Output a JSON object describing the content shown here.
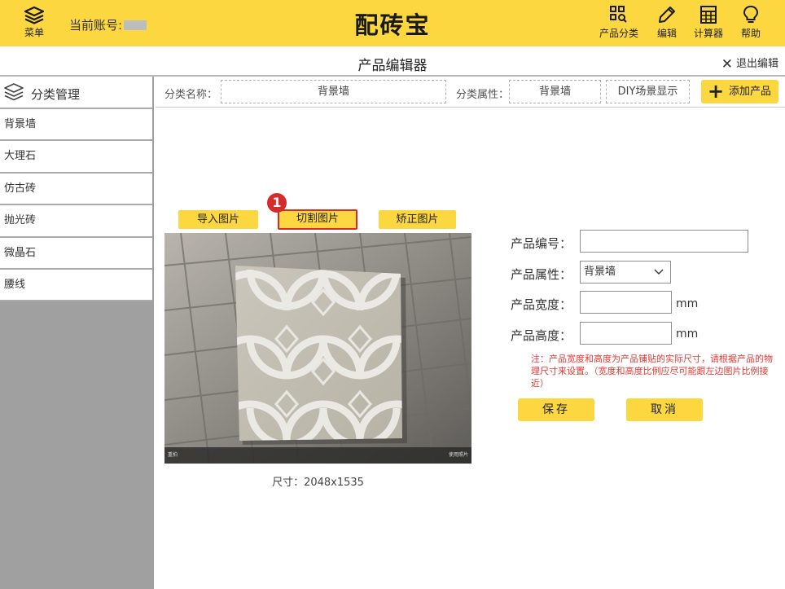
{
  "topbar": {
    "menu_label": "菜单",
    "account_label": "当前账号:",
    "app_title": "配砖宝",
    "tools": [
      {
        "label": "产品分类",
        "icon": "category-search-icon"
      },
      {
        "label": "编辑",
        "icon": "pencil-icon"
      },
      {
        "label": "计算器",
        "icon": "calculator-icon"
      },
      {
        "label": "帮助",
        "icon": "lightbulb-icon"
      }
    ],
    "accent_color": "#fcd73f"
  },
  "subheader": {
    "title": "产品编辑器",
    "exit_label": "退出编辑"
  },
  "sidebar": {
    "title": "分类管理",
    "items": [
      {
        "label": "背景墙"
      },
      {
        "label": "大理石"
      },
      {
        "label": "仿古砖"
      },
      {
        "label": "抛光砖"
      },
      {
        "label": "微晶石"
      },
      {
        "label": "腰线"
      }
    ]
  },
  "filter": {
    "category_name_label": "分类名称：",
    "category_name_value": "背景墙",
    "category_attr_label": "分类属性：",
    "category_attr_value": "背景墙",
    "diy_label": "DIY场景显示",
    "add_product_label": "添加产品"
  },
  "image_tools": {
    "import_label": "导入图片",
    "cut_label": "切割图片",
    "correct_label": "矫正图片",
    "step_badge": "1"
  },
  "photo": {
    "strip_left": "重拍",
    "strip_right": "使用照片",
    "size_text": "尺寸：2048x1535"
  },
  "form": {
    "product_no_label": "产品编号：",
    "product_no_value": "",
    "product_attr_label": "产品属性：",
    "product_attr_selected": "背景墙",
    "width_label": "产品宽度：",
    "width_value": "",
    "height_label": "产品高度：",
    "height_value": "",
    "unit": "mm",
    "note": "注：产品宽度和高度为产品铺贴的实际尺寸，请根据产品的物理尺寸来设置。（宽度和高度比例应尽可能跟左边图片比例接近）",
    "save_label": "保存",
    "cancel_label": "取消"
  }
}
